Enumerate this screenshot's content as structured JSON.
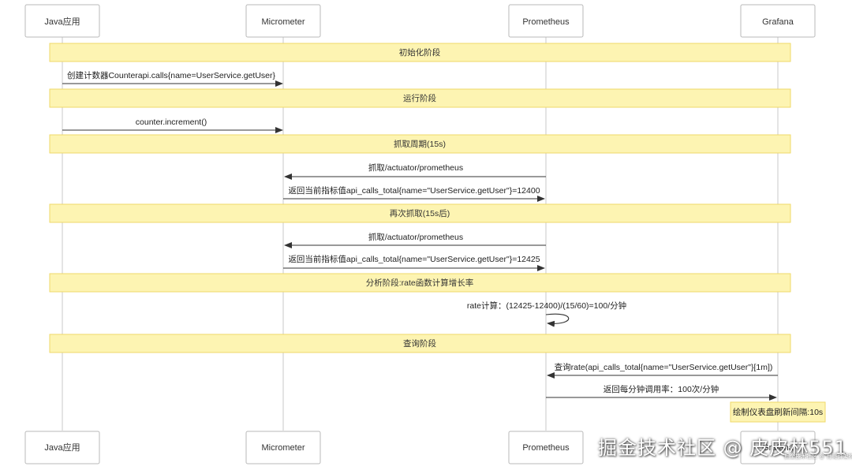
{
  "participants": [
    "Java应用",
    "Micrometer",
    "Prometheus",
    "Grafana"
  ],
  "phases": {
    "init": "初始化阶段",
    "run": "运行阶段",
    "scrape": "抓取周期(15s)",
    "rescrape": "再次抓取(15s后)",
    "analyze": "分析阶段:rate函数计算增长率",
    "query": "查询阶段"
  },
  "messages": {
    "create_counter": "创建计数器Counterapi.calls{name=UserService.getUser}",
    "increment": "counter.increment()",
    "scrape1_request": "抓取/actuator/prometheus",
    "scrape1_response": "返回当前指标值api_calls_total{name=\"UserService.getUser\"}=12400",
    "scrape2_request": "抓取/actuator/prometheus",
    "scrape2_response": "返回当前指标值api_calls_total{name=\"UserService.getUser\"}=12425",
    "rate_calc": "rate计算：(12425-12400)/(15/60)=100/分钟",
    "query_request": "查询rate(api_calls_total{name=\"UserService.getUser\"}[1m])",
    "query_response": "返回每分钟调用率：100次/分钟"
  },
  "note": "绘制仪表盘刷新间隔:10s",
  "watermark": {
    "main": "掘金技术社区 @ 皮皮林551",
    "sub": "掘金技术社区 @ 肖哥弹架构"
  },
  "colors": {
    "phase_fill": "#fdf4b2",
    "phase_border": "#efd96a",
    "lifeline": "#c8c8c8",
    "arrow": "#333333"
  }
}
